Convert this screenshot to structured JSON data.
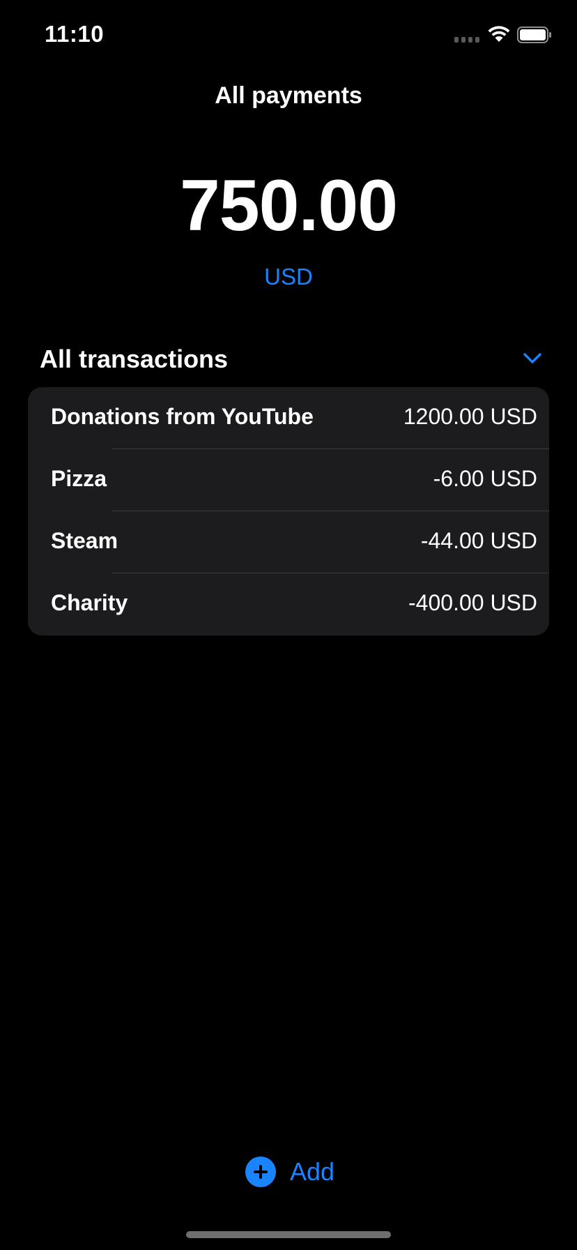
{
  "status_bar": {
    "time": "11:10",
    "signal_icon": "cellular-signal-icon",
    "wifi_icon": "wifi-icon",
    "battery_icon": "battery-icon"
  },
  "header": {
    "title": "All payments"
  },
  "balance": {
    "amount": "750.00",
    "currency": "USD",
    "accent_color": "#1a84ff"
  },
  "transactions": {
    "section_title": "All transactions",
    "toggle_icon": "chevron-down-icon",
    "items": [
      {
        "label": "Donations from YouTube",
        "amount": "1200.00 USD"
      },
      {
        "label": "Pizza",
        "amount": "-6.00 USD"
      },
      {
        "label": "Steam",
        "amount": "-44.00 USD"
      },
      {
        "label": "Charity",
        "amount": "-400.00 USD"
      }
    ]
  },
  "footer": {
    "add_label": "Add",
    "add_icon": "plus-circle-icon"
  },
  "colors": {
    "background": "#000000",
    "card": "#1c1c1e",
    "accent": "#1a84ff",
    "text": "#ffffff"
  }
}
